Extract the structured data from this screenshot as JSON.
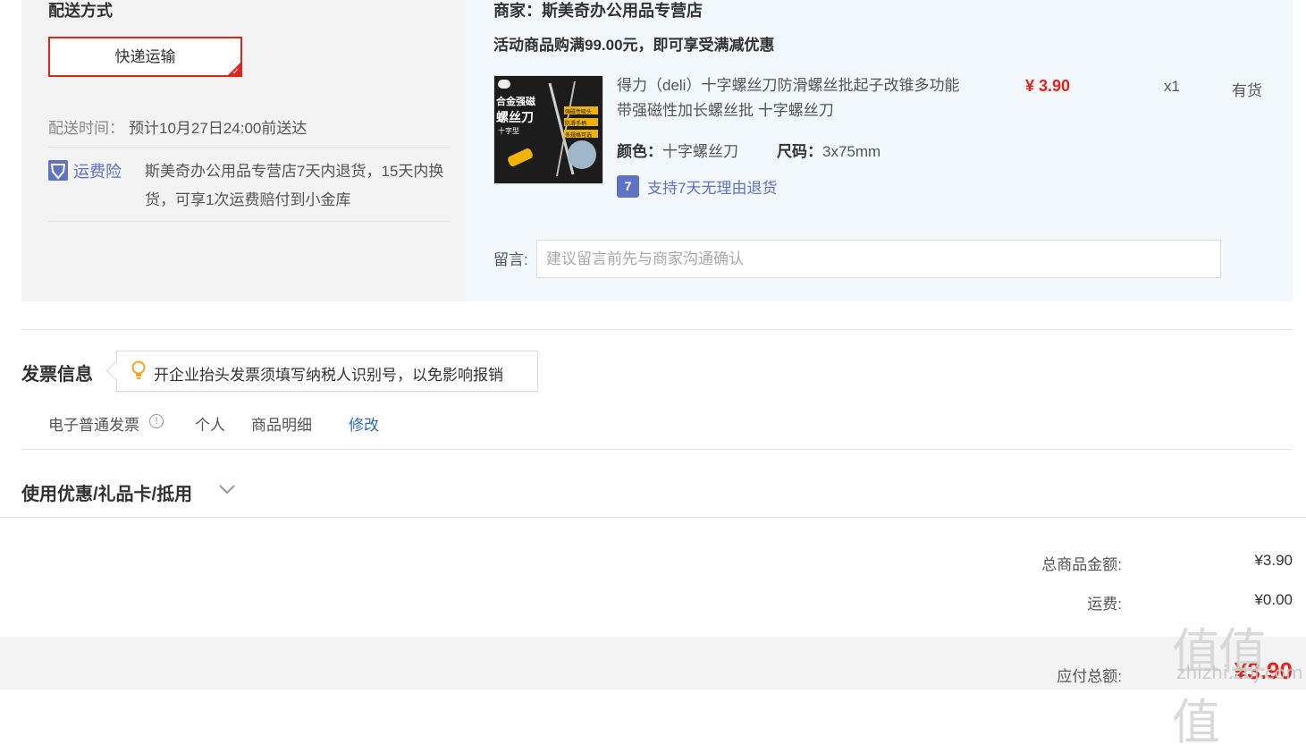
{
  "shipping": {
    "heading": "配送方式",
    "method": "快递运输",
    "time_label": "配送时间：",
    "time_value": "预计10月27日24:00前送达",
    "insurance_label": "运费险",
    "insurance_text": "斯美奇办公用品专营店7天内退货，15天内换货，可享1次运费赔付到小金库"
  },
  "seller": {
    "name": "商家：斯美奇办公用品专营店",
    "promo": "活动商品购满99.00元，即可享受满减优惠"
  },
  "product": {
    "title": "得力（deli）十字螺丝刀防滑螺丝批起子改锥多功能带强磁性加长螺丝批 十字螺丝刀",
    "price": "¥ 3.90",
    "qty": "x1",
    "stock": "有货",
    "color_label": "颜色：",
    "color_value": "十字螺丝刀",
    "size_label": "尺码：",
    "size_value": "3x75mm",
    "return_policy": "支持7天无理由退货",
    "image_text": {
      "line1": "合金强磁",
      "line2": "螺丝刀",
      "line3": "十字型",
      "badge1": "强磁性吸头",
      "badge2": "防滑手柄",
      "badge3": "多规格可选"
    }
  },
  "message": {
    "label": "留言:",
    "placeholder": "建议留言前先与商家沟通确认"
  },
  "invoice": {
    "title": "发票信息",
    "tip": "开企业抬头发票须填写纳税人识别号，以免影响报销",
    "type": "电子普通发票",
    "holder": "个人",
    "content": "商品明细",
    "modify": "修改"
  },
  "coupon": {
    "title": "使用优惠/礼品卡/抵用"
  },
  "summary": {
    "goods_label": "总商品金额:",
    "goods_value": "¥3.90",
    "freight_label": "运费:",
    "freight_value": "¥0.00",
    "total_label": "应付总额:",
    "total_value": "¥3.90"
  },
  "watermark": {
    "glyphs": "值值值",
    "site": "zhizhi.zbj.com"
  },
  "colors": {
    "accent_red": "#e2231a",
    "insurance_blue": "#5f72c4",
    "link_blue": "#2a6db5"
  }
}
